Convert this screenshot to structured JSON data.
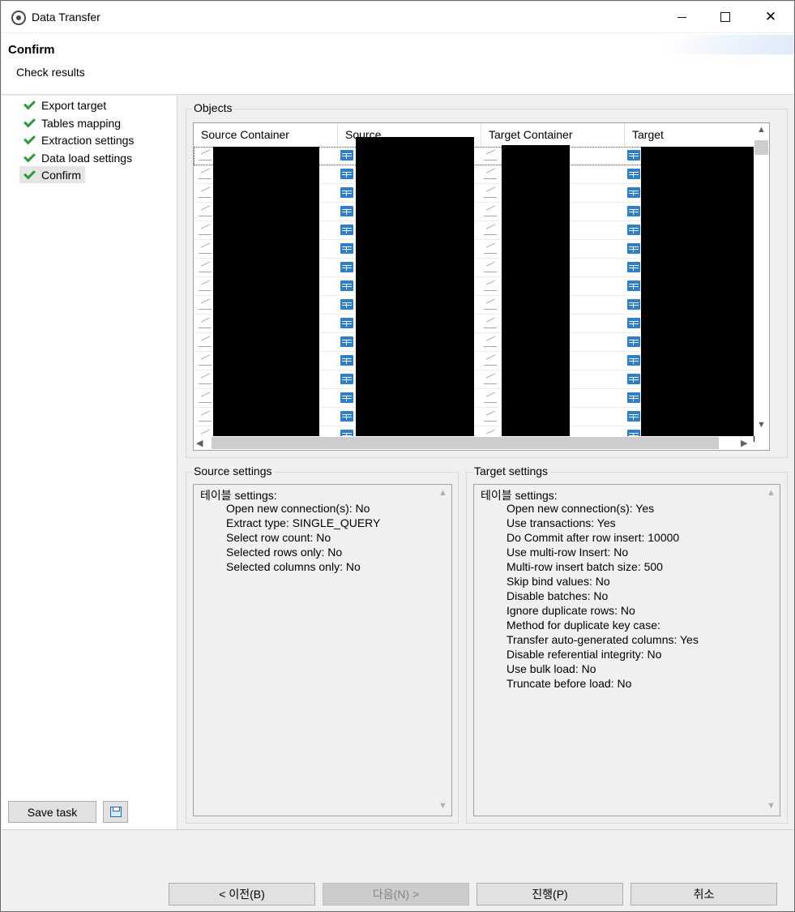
{
  "window": {
    "title": "Data Transfer"
  },
  "banner": {
    "title": "Confirm",
    "subtitle": "Check results"
  },
  "steps": [
    {
      "label": "Export target"
    },
    {
      "label": "Tables mapping"
    },
    {
      "label": "Extraction settings"
    },
    {
      "label": "Data load settings"
    },
    {
      "label": "Confirm",
      "active": true
    }
  ],
  "sidebar": {
    "save_task_label": "Save task"
  },
  "objects": {
    "group_label": "Objects",
    "columns": [
      "Source Container",
      "Source",
      "Target Container",
      "Target"
    ],
    "row_count_visible": 16
  },
  "source_settings": {
    "group_label": "Source settings",
    "header": "테이블 settings:",
    "lines": [
      "Open new connection(s): No",
      "Extract type: SINGLE_QUERY",
      "Select row count: No",
      "Selected rows only: No",
      "Selected columns only: No"
    ]
  },
  "target_settings": {
    "group_label": "Target settings",
    "header": "테이블 settings:",
    "lines": [
      "Open new connection(s): Yes",
      "Use transactions: Yes",
      "Do Commit after row insert: 10000",
      "Use multi-row Insert: No",
      "Multi-row insert batch size: 500",
      "Skip bind values: No",
      "Disable batches: No",
      "Ignore duplicate rows: No",
      "Method for duplicate key case:",
      "Transfer auto-generated columns: Yes",
      "Disable referential integrity: No",
      "Use bulk load: No",
      "Truncate before load: No"
    ]
  },
  "buttons": {
    "back": "< 이전(B)",
    "next": "다음(N) >",
    "proceed": "진행(P)",
    "cancel": "취소"
  }
}
